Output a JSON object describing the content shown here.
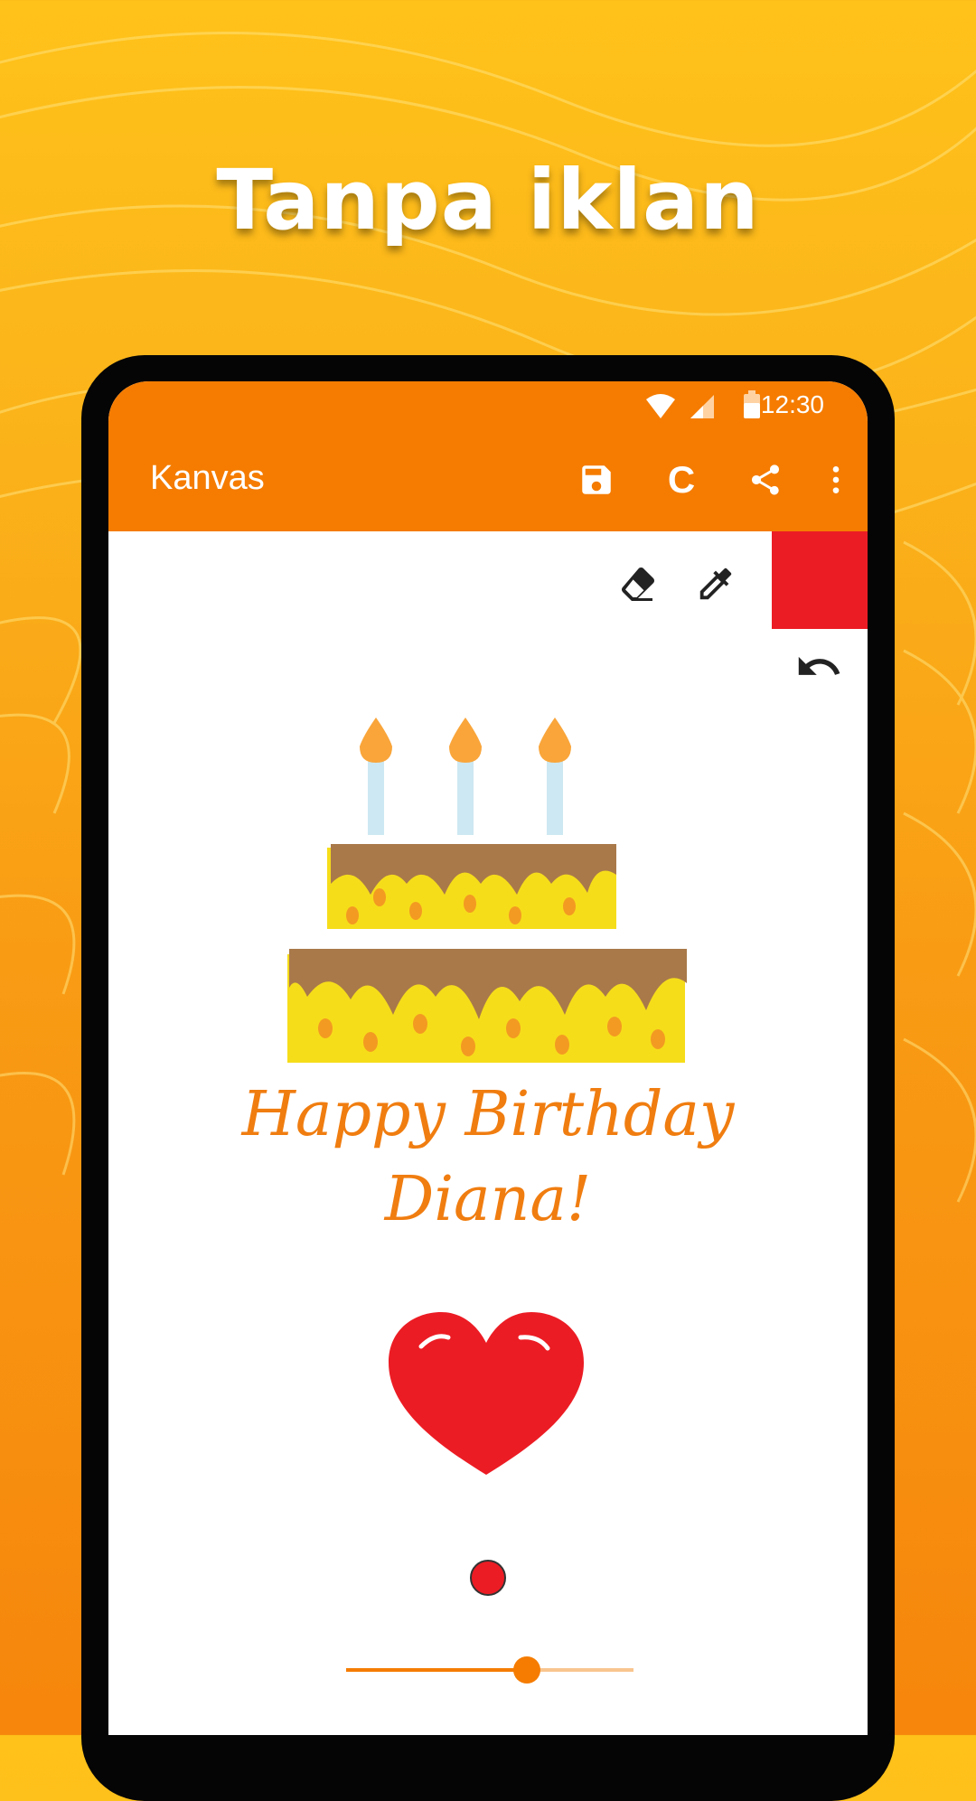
{
  "headline": "Tanpa iklan",
  "status_bar": {
    "time": "12:30",
    "icons": [
      "wifi-icon",
      "signal-icon",
      "battery-icon"
    ]
  },
  "app_bar": {
    "title": "Kanvas",
    "actions": [
      {
        "name": "save",
        "icon": "save-icon"
      },
      {
        "name": "clear",
        "label": "C"
      },
      {
        "name": "share",
        "icon": "share-icon"
      },
      {
        "name": "more",
        "icon": "more-vert-icon"
      }
    ]
  },
  "toolbar": {
    "tools": [
      "eraser-icon",
      "eyedropper-icon",
      "undo-icon"
    ],
    "selected_color": "#ec1c24"
  },
  "drawing": {
    "greeting_line1": "Happy Birthday",
    "greeting_line2": "Diana!",
    "elements": [
      "cake-drawing",
      "heart-drawing"
    ]
  },
  "brush": {
    "color": "#ec1c24",
    "size_fraction": 0.63
  },
  "colors": {
    "accent": "#f57c00",
    "text_orange": "#f07d10",
    "heart_red": "#ec1c24"
  }
}
